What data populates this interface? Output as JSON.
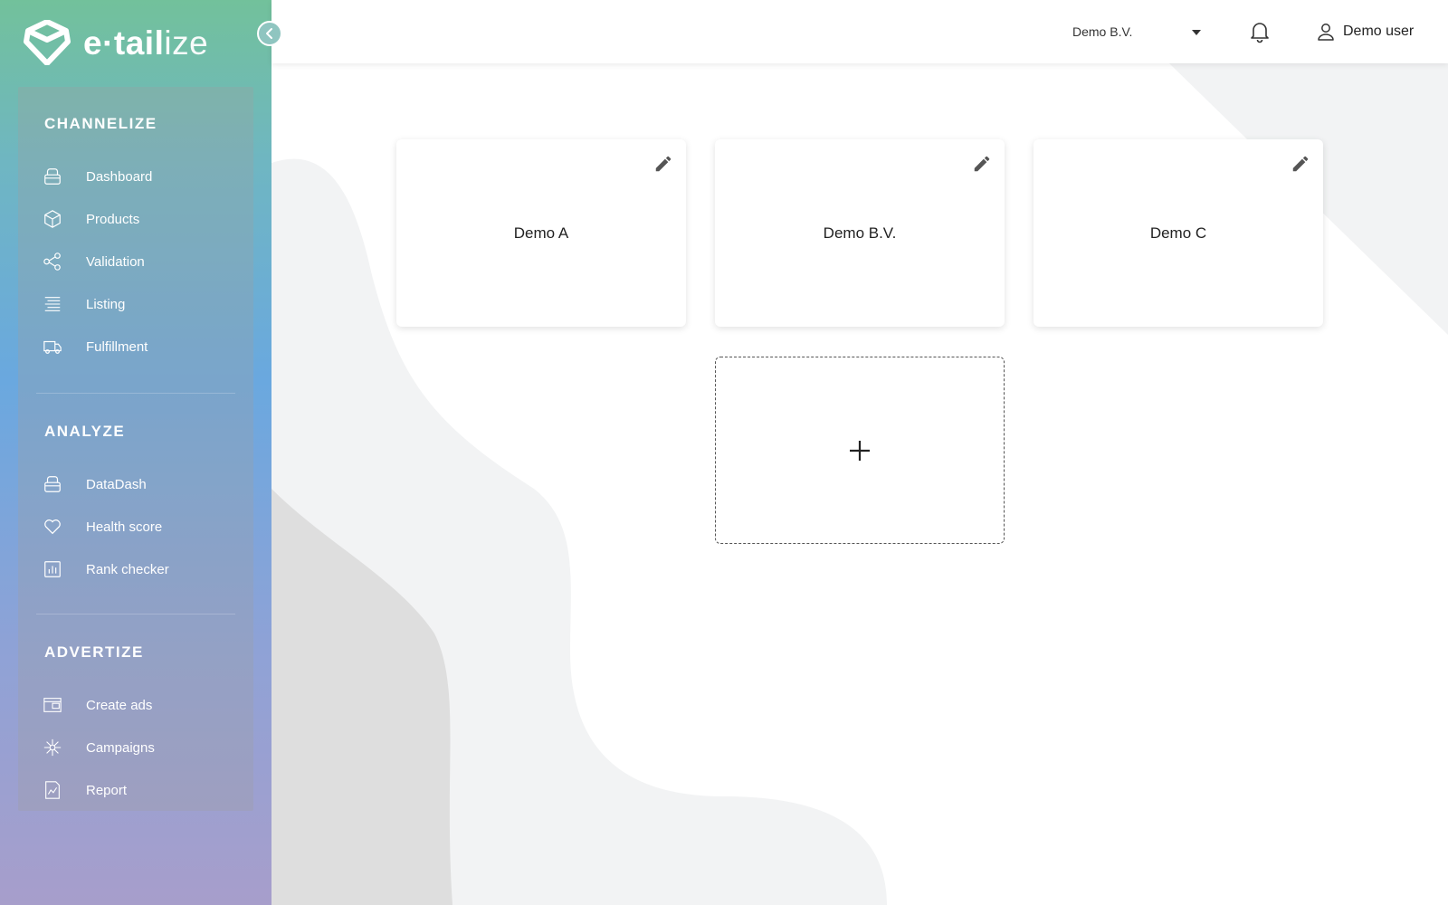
{
  "brand": {
    "logo_text_bold": "e·tail",
    "logo_text_light": "ize",
    "logo_icon": "etailize-logo-icon"
  },
  "sidebar": {
    "collapse_icon": "chevron-left-icon",
    "sections": [
      {
        "title": "CHANNELIZE",
        "items": [
          {
            "label": "Dashboard",
            "icon": "dashboard-icon"
          },
          {
            "label": "Products",
            "icon": "box-icon"
          },
          {
            "label": "Validation",
            "icon": "share-nodes-icon"
          },
          {
            "label": "Listing",
            "icon": "list-icon"
          },
          {
            "label": "Fulfillment",
            "icon": "truck-icon"
          }
        ]
      },
      {
        "title": "ANALYZE",
        "items": [
          {
            "label": "DataDash",
            "icon": "dashboard-icon"
          },
          {
            "label": "Health score",
            "icon": "heart-icon"
          },
          {
            "label": "Rank checker",
            "icon": "bar-chart-icon"
          }
        ]
      },
      {
        "title": "ADVERTIZE",
        "items": [
          {
            "label": "Create ads",
            "icon": "ads-icon"
          },
          {
            "label": "Campaigns",
            "icon": "network-icon"
          },
          {
            "label": "Report",
            "icon": "report-icon"
          }
        ]
      }
    ]
  },
  "header": {
    "company_select": {
      "value": "Demo B.V."
    },
    "notifications_icon": "bell-icon",
    "user": {
      "name": "Demo user",
      "icon": "user-icon"
    }
  },
  "companies": [
    {
      "name": "Demo A"
    },
    {
      "name": "Demo B.V."
    },
    {
      "name": "Demo C"
    }
  ],
  "add_company": {
    "icon": "plus-icon"
  },
  "colors": {
    "sidebar_gradient_top": "#72c19b",
    "sidebar_gradient_middle": "#6aa8df",
    "sidebar_gradient_bottom": "#a79ecb",
    "background_shape_light": "#f2f3f4",
    "background_shape_dark": "#dedede"
  }
}
